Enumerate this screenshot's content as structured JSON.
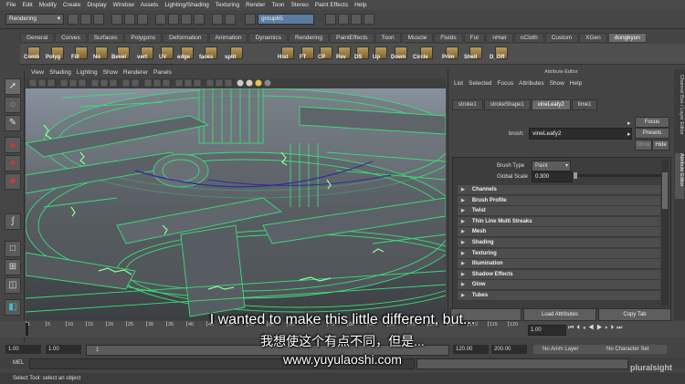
{
  "menubar": [
    "File",
    "Edit",
    "Modify",
    "Create",
    "Display",
    "Window",
    "Assets",
    "Lighting/Shading",
    "Texturing",
    "Render",
    "Toon",
    "Stereo",
    "Paint Effects",
    "Help"
  ],
  "statusline": {
    "menuset": "Rendering",
    "selection_field": "group65"
  },
  "shelf": {
    "tabs": [
      "General",
      "Curves",
      "Surfaces",
      "Polygons",
      "Deformation",
      "Animation",
      "Dynamics",
      "Rendering",
      "PaintEffects",
      "Toon",
      "Muscle",
      "Fluids",
      "Fur",
      "nHair",
      "nCloth",
      "Custom",
      "XGen",
      "dongkyun"
    ],
    "active_tab": "dongkyun",
    "buttons": [
      "Comb",
      "Polyg",
      "Fill",
      "No",
      "Bevel",
      "vert",
      "UV",
      "edge",
      "faces",
      "split",
      "Hist",
      "FT",
      "CP",
      "Rev",
      "DS",
      "Up",
      "Down",
      "Circle",
      "Prim",
      "Shell",
      "D_Off"
    ]
  },
  "viewport": {
    "menu": [
      "View",
      "Shading",
      "Lighting",
      "Show",
      "Renderer",
      "Panels"
    ]
  },
  "attribute_editor": {
    "title": "Attribute Editor",
    "menu": [
      "List",
      "Selected",
      "Focus",
      "Attributes",
      "Show",
      "Help"
    ],
    "tabs": [
      "stroke1",
      "strokeShape1",
      "vineLeafy2",
      "time1"
    ],
    "active_tab": "vineLeafy2",
    "brush_label": "brush:",
    "brush_value": "vineLeafy2",
    "focus_label": "Focus",
    "presets_label": "Presets",
    "show_label": "Show",
    "hide_label": "Hide",
    "brush_type_label": "Brush Type",
    "brush_type_value": "Paint",
    "global_scale_label": "Global Scale",
    "global_scale_value": "0.300",
    "sections": [
      "Channels",
      "Brush Profile",
      "Twist",
      "Thin Line Multi Streaks",
      "Mesh",
      "Shading",
      "Texturing",
      "Illumination",
      "Shadow Effects",
      "Glow",
      "Tubes"
    ],
    "load_attributes": "Load Attributes",
    "copy_tab": "Copy Tab"
  },
  "side_tabs": [
    "Channel Box / Layer Editor",
    "Attribute Editor"
  ],
  "timeslider": {
    "ticks": [
      "1",
      "5",
      "10",
      "15",
      "20",
      "25",
      "30",
      "35",
      "40",
      "45",
      "50",
      "55",
      "60",
      "65",
      "70",
      "75",
      "80",
      "85",
      "90",
      "95",
      "100",
      "105",
      "110",
      "115",
      "120"
    ],
    "current": "1.00"
  },
  "range": {
    "start_a": "1.00",
    "start_b": "1.00",
    "frame": "1",
    "end_a": "120.00",
    "end_b": "200.00",
    "anim_layer": "No Anim Layer",
    "char_set": "No Character Set"
  },
  "mel": {
    "label": "MEL"
  },
  "helpline": "Select Tool: select an object",
  "watermark": "pluralsight",
  "subtitles": {
    "english": "I wanted to make this little different, but...",
    "chinese": "我想使这个有点不同，但是...",
    "url": "www.yuyulaoshi.com"
  },
  "colors": {
    "wire": "#3bdc7a",
    "accent": "#5b9bd5"
  }
}
